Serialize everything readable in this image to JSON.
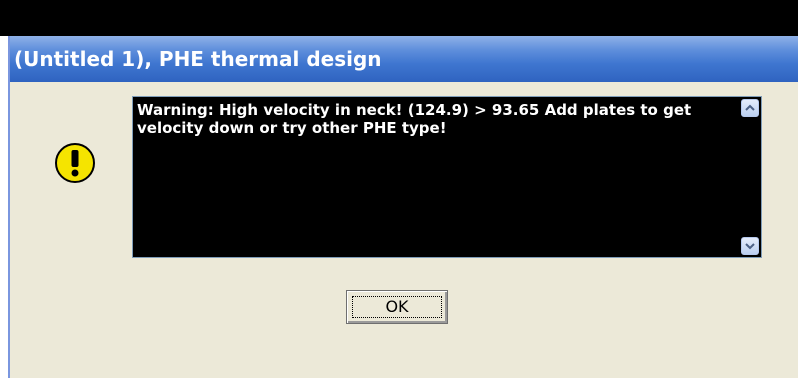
{
  "window": {
    "title": "(Untitled 1), PHE thermal design"
  },
  "message": {
    "text": "Warning: High velocity in neck! (124.9) > 93.65 Add plates to get velocity down or try other PHE type!"
  },
  "buttons": {
    "ok_label": "OK"
  },
  "icons": {
    "warning": "exclamation-warning-icon",
    "scroll_up": "chevron-up-icon",
    "scroll_down": "chevron-down-icon"
  },
  "colors": {
    "title_bar": "#3f76d0",
    "dialog_bg": "#ece9d8",
    "message_bg": "#000000",
    "message_text": "#ffffff",
    "warning_icon": "#f5e400"
  }
}
